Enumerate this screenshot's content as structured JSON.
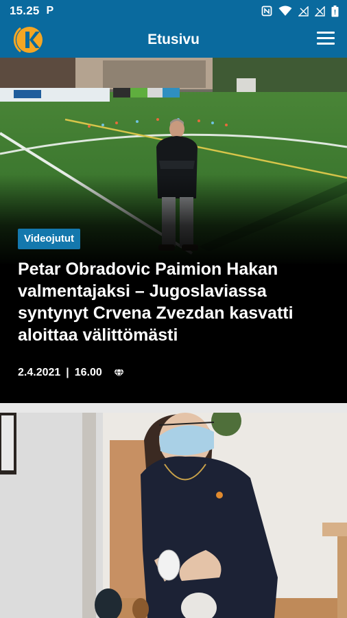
{
  "status_bar": {
    "time": "15.25",
    "notification_icon": "P",
    "icons": [
      "nfc-icon",
      "wifi-icon",
      "signal-icon",
      "signal-icon",
      "battery-icon"
    ]
  },
  "app_bar": {
    "title": "Etusivu",
    "logo_icon": "k-logo",
    "menu_icon": "hamburger-menu-icon"
  },
  "articles": [
    {
      "category": "Videojutut",
      "headline": "Petar Obradovic Paimion Hakan valmentajaksi – Jugoslaviassa syntynyt Crvena Zvezdan kasvatti aloittaa välittömästi",
      "date": "2.4.2021",
      "separator": "|",
      "time": "16.00",
      "premium_icon": "diamond-icon"
    }
  ],
  "colors": {
    "brand_blue": "#0a6a9e",
    "tag_blue": "#1478ad",
    "logo_orange": "#f5a623"
  }
}
